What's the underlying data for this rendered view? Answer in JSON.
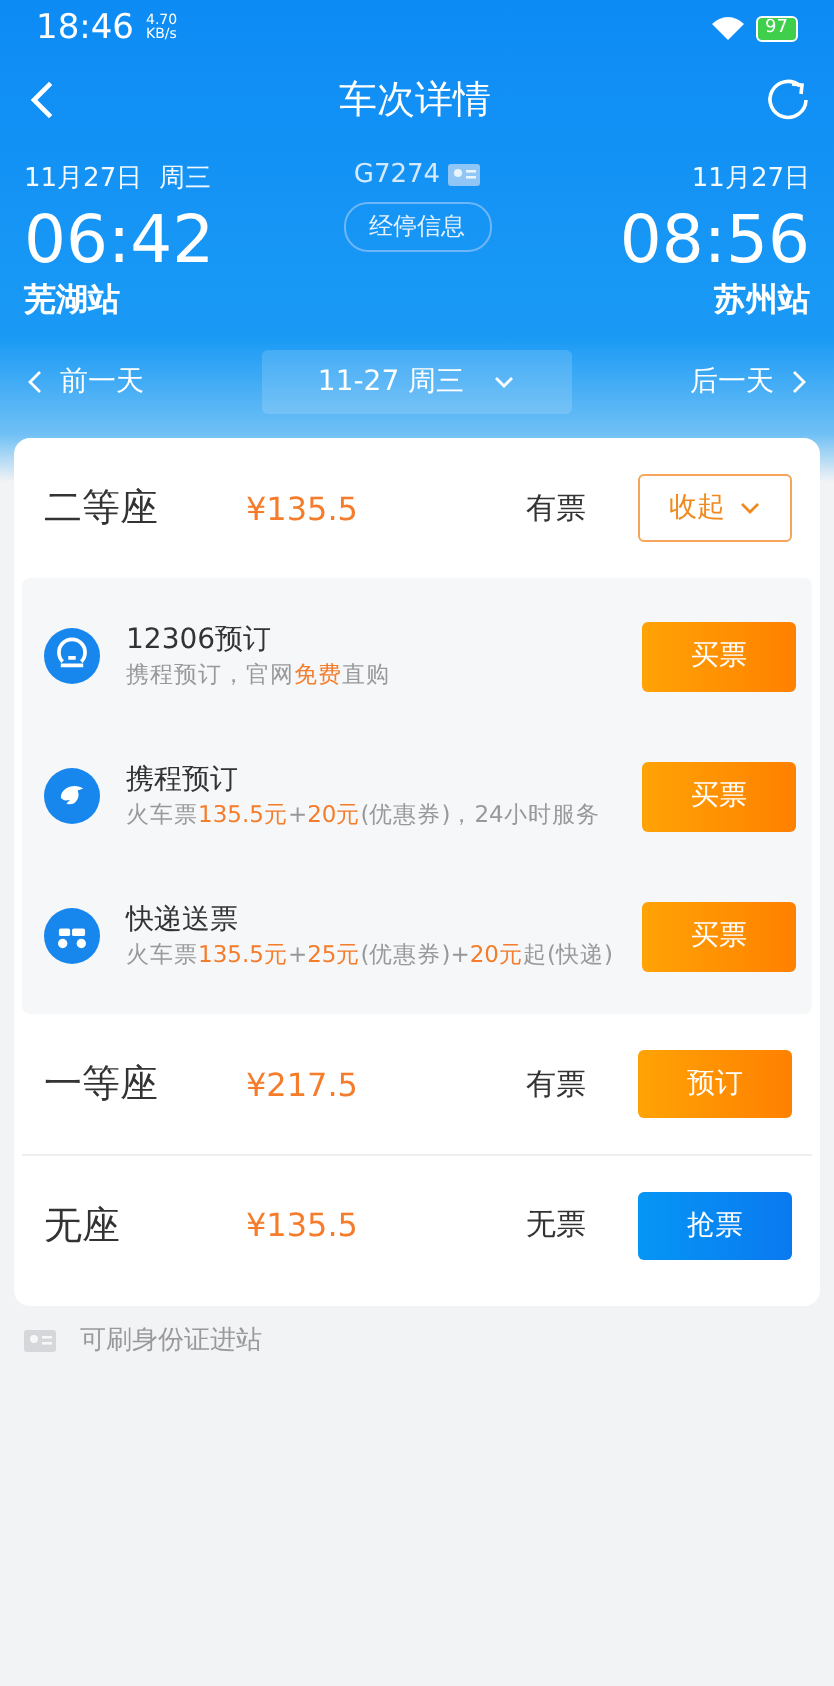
{
  "status_bar": {
    "time": "18:46",
    "speed": "4.70\nKB/s",
    "battery": "97"
  },
  "header": {
    "title": "车次详情",
    "depart": {
      "date": "11月27日  周三",
      "time": "06:42",
      "station": "芜湖站"
    },
    "arrive": {
      "date": "11月27日",
      "time": "08:56",
      "station": "苏州站"
    },
    "train": "G7274",
    "stops_button": "经停信息"
  },
  "day_nav": {
    "prev": "前一天",
    "current": "11-27 周三",
    "next": "后一天"
  },
  "seats": [
    {
      "name": "二等座",
      "price": "¥135.5",
      "availability": "有票",
      "button": {
        "label": "收起",
        "kind": "outline"
      },
      "expanded": true,
      "options": [
        {
          "kind": "rail",
          "title": "12306预订",
          "description": [
            {
              "text": "携程预订，官网",
              "highlight": false
            },
            {
              "text": "免费",
              "highlight": true
            },
            {
              "text": "直购",
              "highlight": false
            }
          ],
          "button": "买票"
        },
        {
          "kind": "dolphin",
          "title": "携程预订",
          "description": [
            {
              "text": "火车票",
              "highlight": false
            },
            {
              "text": "135.5元",
              "highlight": true
            },
            {
              "text": "+",
              "highlight": false
            },
            {
              "text": "20元",
              "highlight": true
            },
            {
              "text": "(优惠券)，24小时服务",
              "highlight": false
            }
          ],
          "button": "买票"
        },
        {
          "kind": "scooter",
          "title": "快递送票",
          "description": [
            {
              "text": "火车票",
              "highlight": false
            },
            {
              "text": "135.5元",
              "highlight": true
            },
            {
              "text": "+",
              "highlight": false
            },
            {
              "text": "25元",
              "highlight": true
            },
            {
              "text": "(优惠券)+",
              "highlight": false
            },
            {
              "text": "20元",
              "highlight": true
            },
            {
              "text": "起(快递)",
              "highlight": false
            }
          ],
          "button": "买票"
        }
      ]
    },
    {
      "name": "一等座",
      "price": "¥217.5",
      "availability": "有票",
      "button": {
        "label": "预订",
        "kind": "orange"
      },
      "expanded": false
    },
    {
      "name": "无座",
      "price": "¥135.5",
      "availability": "无票",
      "button": {
        "label": "抢票",
        "kind": "blue"
      },
      "expanded": false
    }
  ],
  "footer_note": "可刷身份证进站"
}
